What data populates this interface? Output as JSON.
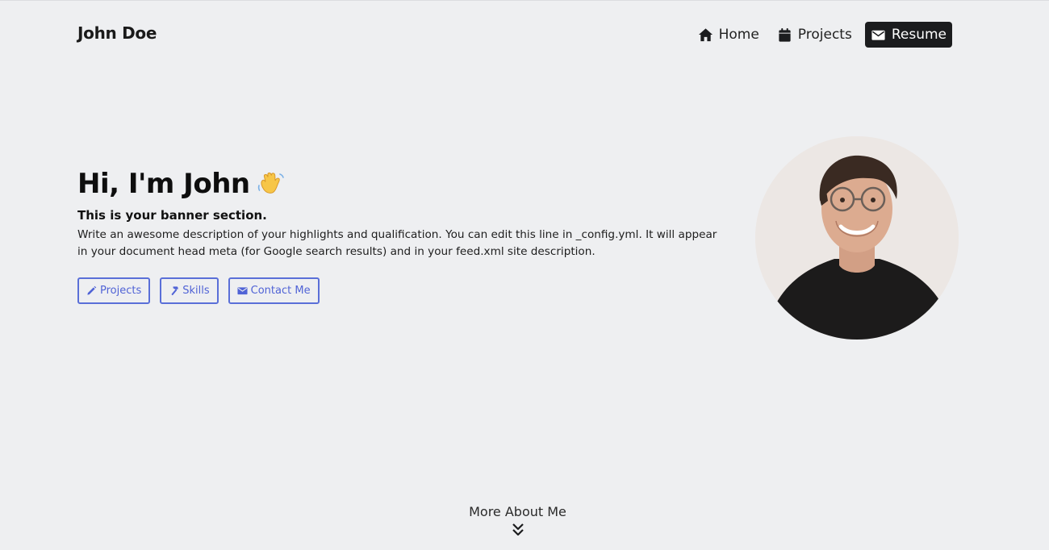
{
  "header": {
    "brand": "John Doe",
    "nav": [
      {
        "label": "Home",
        "icon": "home-icon"
      },
      {
        "label": "Projects",
        "icon": "calendar-icon"
      },
      {
        "label": "Resume",
        "icon": "envelope-icon",
        "active": true
      }
    ]
  },
  "hero": {
    "title": "Hi, I'm John",
    "wave_icon": "waving-hand-emoji",
    "subtitle": "This is your banner section.",
    "description": "Write an awesome description of your highlights and qualification. You can edit this line in _config.yml. It will appear in your document head meta (for Google search results) and in your feed.xml site description.",
    "buttons": [
      {
        "label": "Projects",
        "icon": "pencil-icon"
      },
      {
        "label": "Skills",
        "icon": "hammer-icon"
      },
      {
        "label": "Contact Me",
        "icon": "envelope-icon"
      }
    ]
  },
  "footer": {
    "more_label": "More About Me",
    "more_icon": "double-chevron-down-icon"
  },
  "colors": {
    "background": "#eeeff1",
    "accent": "#5063d6",
    "active_nav_bg": "#1b1c1e"
  }
}
